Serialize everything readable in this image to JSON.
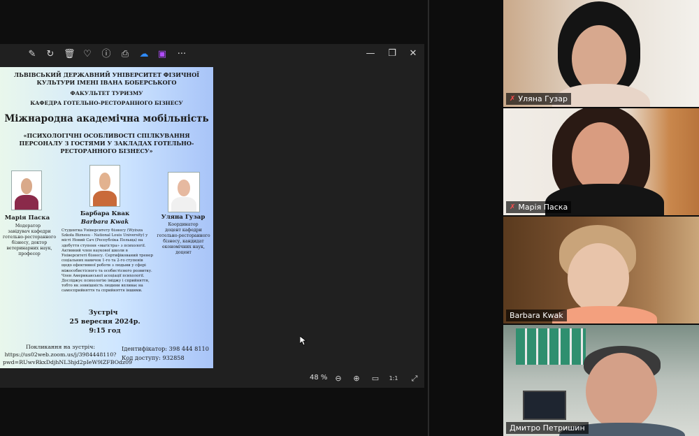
{
  "viewer": {
    "toolbar_icons": [
      "edit-icon",
      "rotate-icon",
      "delete-icon",
      "favorite-icon",
      "info-icon",
      "print-icon",
      "cloud-icon",
      "video-editor-icon",
      "more-icon"
    ],
    "toolbar_glyphs": [
      "✎",
      "↻",
      "🗑",
      "♡",
      "ⓘ",
      "⎙",
      "☁",
      "▣",
      "···"
    ],
    "window_glyphs": {
      "minimize": "—",
      "restore": "❐",
      "close": "✕"
    },
    "zoom": "48 %",
    "status_glyphs": {
      "zoom_out": "⊖",
      "zoom_in": "⊕",
      "fit": "▭",
      "actual": "1:1",
      "fullscreen": "⤢"
    }
  },
  "poster": {
    "university": "ЛЬВІВСЬКИЙ ДЕРЖАВНИЙ УНІВЕРСИТЕТ ФІЗИЧНОЇ КУЛЬТУРИ ІМЕНІ ІВАНА БОБЕРСЬКОГО",
    "faculty": "ФАКУЛЬТЕТ ТУРИЗМУ",
    "department": "КАФЕДРА ГОТЕЛЬНО-РЕСТОРАННОГО БІЗНЕСУ",
    "title": "Міжнародна академічна мобільність",
    "subtitle": "«ПСИХОЛОГІЧНІ ОСОБЛИВОСТІ СПІЛКУВАННЯ ПЕРСОНАЛУ З ГОСТЯМИ У ЗАКЛАДАХ ГОТЕЛЬНО-РЕСТОРАННОГО БІЗНЕСУ»",
    "speakers": [
      {
        "name": "Марія Паска",
        "role": "Модератор",
        "desc": "завідувач кафедри готельно-ресторанного бізнесу, доктор ветеринарних наук, професор"
      },
      {
        "name": "Барбара Квак",
        "name_latin": "Barbara Kwak",
        "bio": "Студентка Університету бізнесу (Wyższa Szkoła Biznesu - National Louis University) у місті Новий Сач (Республіка Польща) на здобуття ступеня «магістра» з психології. Активний член наукової школи в Університеті бізнесу. Сертифікований тренер соціальних навичок 1-го та 2-го ступенів щодо ефективної роботи з людьми у сфері міжособистісного та особистісного розвитку. Член Американської асоціації психології. Досліджує психологію іміджу і сприйняття, тобто як зовнішність людини впливає на самосприйняття та сприйняття іншими."
      },
      {
        "name": "Уляна Гузар",
        "role": "Координатор",
        "desc": "доцент кафедри готельно-ресторанного бізнесу, кандидат економічних наук, доцент"
      }
    ],
    "meeting_label": "Зустріч",
    "meeting_date": "25 вересня 2024р.",
    "meeting_time": "9:15 год",
    "link_label": "Покликання на зустріч:",
    "link_line1": "https://us02web.zoom.us/j/3984448110?",
    "link_line2": "pwd=RUwvRkxDdjhNL3hjd2pIeW9lZFBOdz09",
    "id_label": "Ідентифікатор: 398 444 8110",
    "code_label": "Код доступу: 932858"
  },
  "participants": [
    {
      "name": "Уляна Гузар",
      "muted": true
    },
    {
      "name": "Марія Паска",
      "muted": true
    },
    {
      "name": "Barbara Kwak",
      "muted": false
    },
    {
      "name": "Дмитро Петришин",
      "muted": false
    }
  ],
  "mic_off_glyph": "✗"
}
